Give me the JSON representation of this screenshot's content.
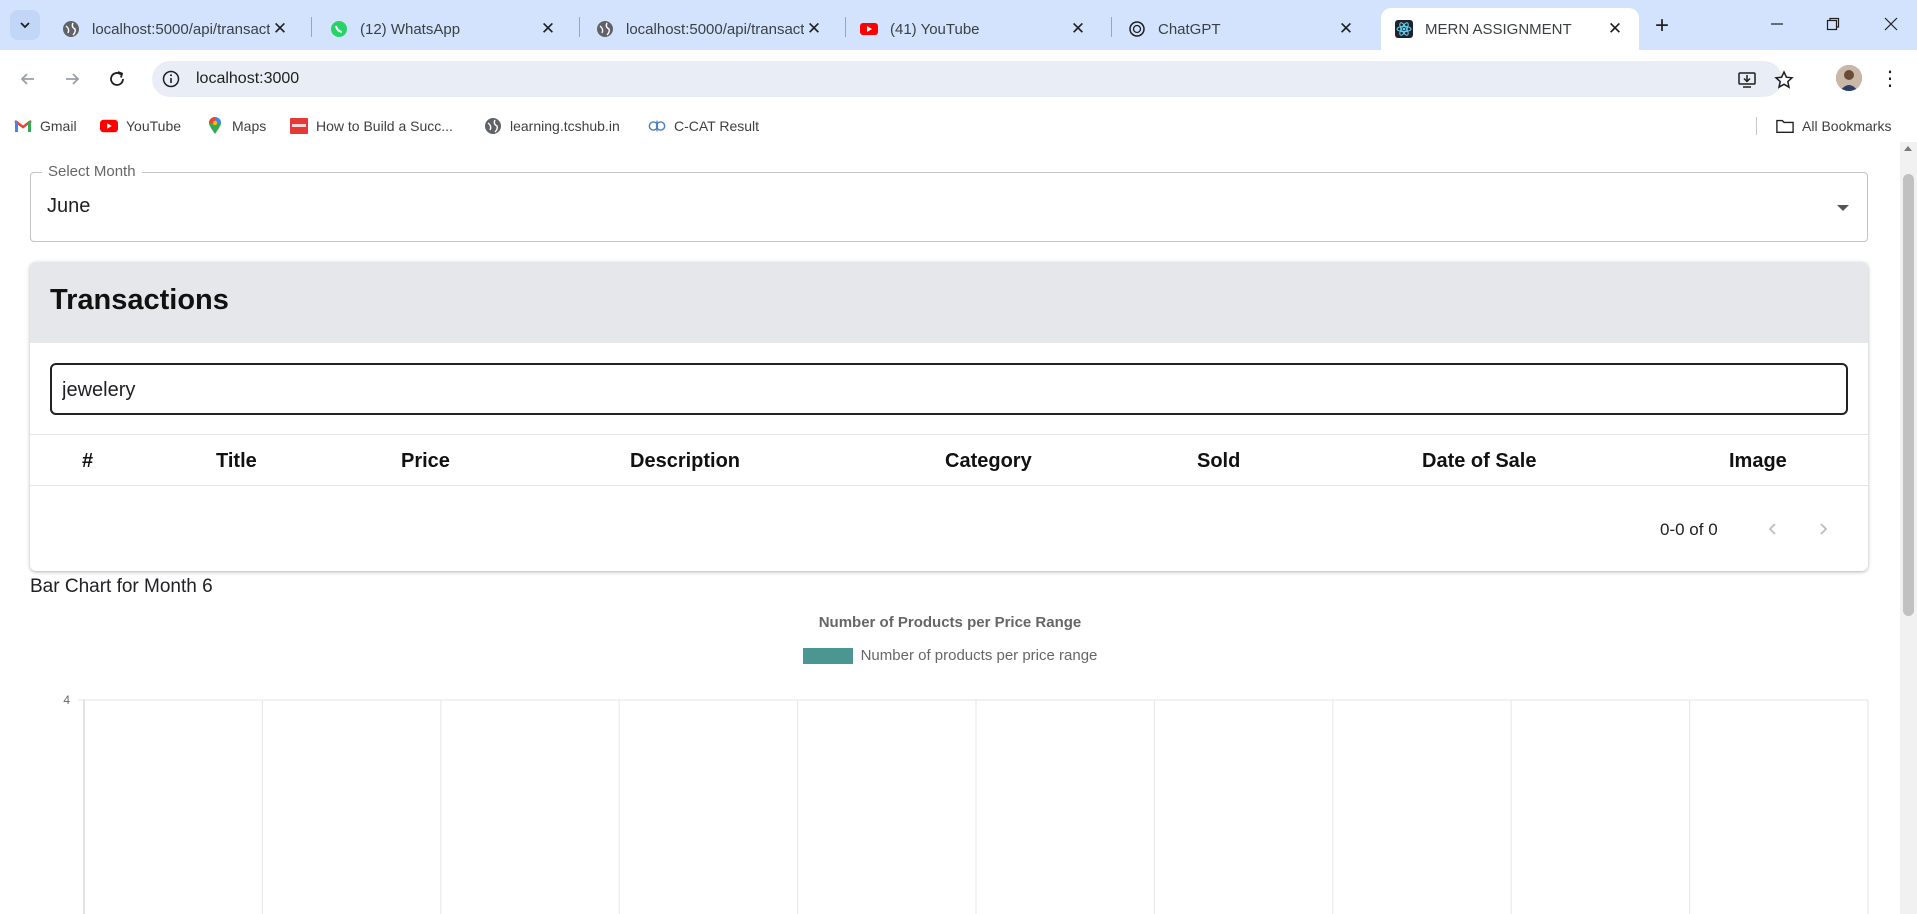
{
  "browser": {
    "tabs": [
      {
        "title": "localhost:5000/api/transacti",
        "icon": "globe-icon",
        "active": false
      },
      {
        "title": "(12) WhatsApp",
        "icon": "whatsapp-icon",
        "active": false
      },
      {
        "title": "localhost:5000/api/transacti",
        "icon": "globe-icon",
        "active": false
      },
      {
        "title": "(41) YouTube",
        "icon": "youtube-icon",
        "active": false
      },
      {
        "title": "ChatGPT",
        "icon": "chatgpt-icon",
        "active": false
      },
      {
        "title": "MERN ASSIGNMENT",
        "icon": "react-icon",
        "active": true
      }
    ],
    "url": "localhost:3000",
    "bookmarks": [
      {
        "label": "Gmail",
        "icon": "gmail-icon"
      },
      {
        "label": "YouTube",
        "icon": "youtube-icon"
      },
      {
        "label": "Maps",
        "icon": "maps-icon"
      },
      {
        "label": "How to Build a Succ...",
        "icon": "bookmark-red-icon"
      },
      {
        "label": "learning.tcshub.in",
        "icon": "globe-icon"
      },
      {
        "label": "C-CAT Result",
        "icon": "cdac-icon"
      }
    ],
    "all_bookmarks_label": "All Bookmarks"
  },
  "page": {
    "month_select": {
      "label": "Select Month",
      "value": "June"
    },
    "transactions": {
      "title": "Transactions",
      "search_value": "jewelery",
      "columns": [
        "#",
        "Title",
        "Price",
        "Description",
        "Category",
        "Sold",
        "Date of Sale",
        "Image"
      ],
      "rows": [],
      "pagination_text": "0-0 of 0"
    },
    "chart_heading": "Bar Chart for Month 6"
  },
  "colors": {
    "tabstrip": "#d3e3fd",
    "card_header": "#e5e7eb",
    "bar_color": "#4b9690"
  },
  "chart_data": {
    "type": "bar",
    "title": "Number of Products per Price Range",
    "series": [
      {
        "name": "Number of products per price range",
        "values": []
      }
    ],
    "categories": [],
    "y_ticks_visible": [
      "4"
    ],
    "grid": true,
    "legend": "top-center"
  }
}
